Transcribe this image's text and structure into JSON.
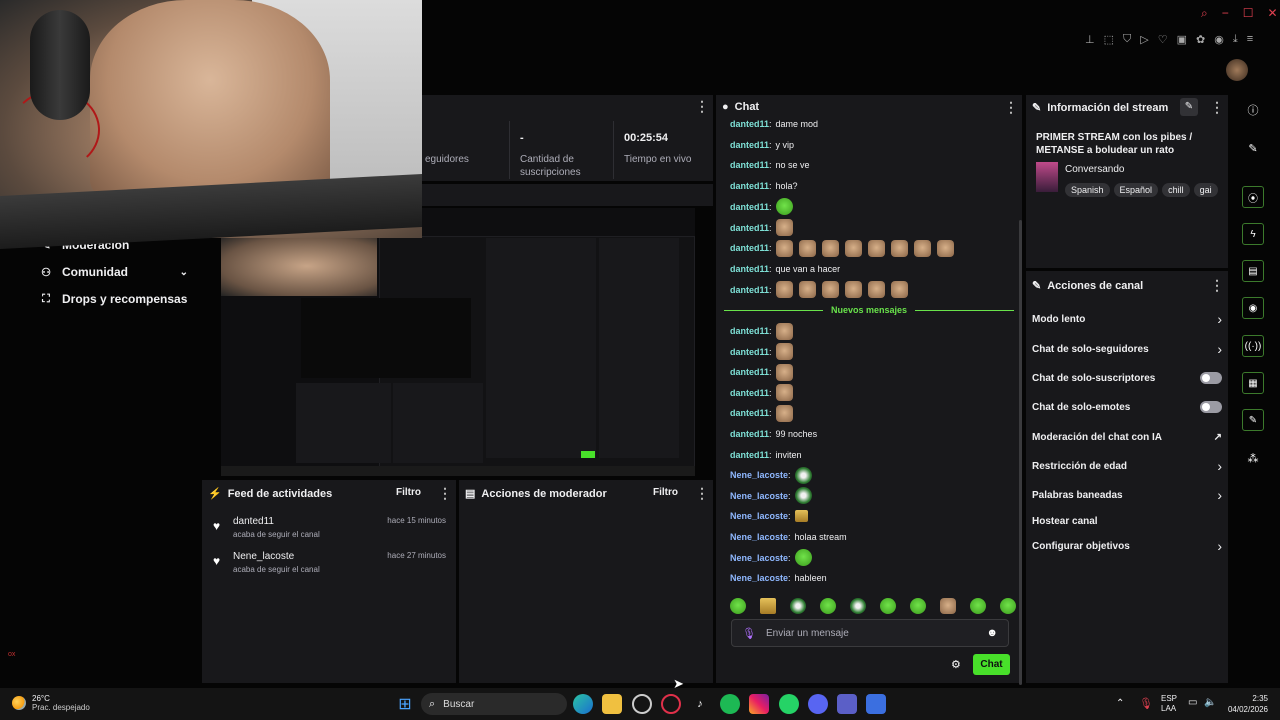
{
  "browser": {
    "window_controls": [
      "−",
      "☐",
      "✕"
    ]
  },
  "nav": {
    "moderacion": "Moderación",
    "comunidad": "Comunidad",
    "drops": "Drops y recompensas"
  },
  "stats": {
    "seguidores_label": "eguidores",
    "subs_value": "-",
    "subs_label_1": "Cantidad de",
    "subs_label_2": "suscripciones",
    "time_value": "00:25:54",
    "time_label": "Tiempo en vivo"
  },
  "feed": {
    "title": "Feed de actividades",
    "filter": "Filtro",
    "items": [
      {
        "name": "danted11",
        "sub": "acaba de seguir el canal",
        "time": "hace 15 minutos"
      },
      {
        "name": "Nene_lacoste",
        "sub": "acaba de seguir el canal",
        "time": "hace 27 minutos"
      }
    ]
  },
  "modactions": {
    "title": "Acciones de moderador",
    "filter": "Filtro"
  },
  "chat": {
    "title": "Chat",
    "messages": [
      {
        "user": "danted11",
        "text": "dame mod",
        "emotes": 0,
        "kind": ""
      },
      {
        "user": "danted11",
        "text": "y vip",
        "emotes": 0,
        "kind": ""
      },
      {
        "user": "danted11",
        "text": "no se ve",
        "emotes": 0,
        "kind": ""
      },
      {
        "user": "danted11",
        "text": "hola?",
        "emotes": 0,
        "kind": ""
      },
      {
        "user": "danted11",
        "text": "",
        "emotes": 1,
        "kind": "g"
      },
      {
        "user": "danted11",
        "text": "",
        "emotes": 1,
        "kind": ""
      },
      {
        "user": "danted11",
        "text": "",
        "emotes": 8,
        "kind": ""
      },
      {
        "user": "danted11",
        "text": "que van a hacer",
        "emotes": 0,
        "kind": ""
      },
      {
        "user": "danted11",
        "text": "",
        "emotes": 6,
        "kind": ""
      }
    ],
    "new_label": "Nuevos mensajes",
    "messages2": [
      {
        "user": "danted11",
        "text": "",
        "emotes": 1,
        "kind": ""
      },
      {
        "user": "danted11",
        "text": "",
        "emotes": 1,
        "kind": ""
      },
      {
        "user": "danted11",
        "text": "",
        "emotes": 1,
        "kind": ""
      },
      {
        "user": "danted11",
        "text": "",
        "emotes": 1,
        "kind": ""
      },
      {
        "user": "danted11",
        "text": "",
        "emotes": 1,
        "kind": ""
      },
      {
        "user": "danted11",
        "text": "99 noches",
        "emotes": 0,
        "kind": ""
      },
      {
        "user": "danted11",
        "text": "inviten",
        "emotes": 0,
        "kind": ""
      },
      {
        "user": "Nene_lacoste",
        "text": "",
        "emotes": 1,
        "kind": "b"
      },
      {
        "user": "Nene_lacoste",
        "text": "",
        "emotes": 1,
        "kind": "b"
      },
      {
        "user": "Nene_lacoste",
        "text": "",
        "emotes": 1,
        "kind": "y"
      },
      {
        "user": "Nene_lacoste",
        "text": "holaa stream",
        "emotes": 0,
        "kind": ""
      },
      {
        "user": "Nene_lacoste",
        "text": "",
        "emotes": 1,
        "kind": "g"
      },
      {
        "user": "Nene_lacoste",
        "text": "hableen",
        "emotes": 0,
        "kind": ""
      }
    ],
    "emote_bar": [
      "g",
      "y",
      "b",
      "g",
      "b",
      "g",
      "g",
      "",
      "g",
      "g"
    ],
    "placeholder": "Enviar un mensaje",
    "send": "Chat"
  },
  "stream_info": {
    "title": "Información del stream",
    "stream_title": "PRIMER STREAM con los pibes / METANSE a boludear un rato",
    "category": "Conversando",
    "tags": [
      "Spanish",
      "Español",
      "chill",
      "gai"
    ]
  },
  "channel_actions": {
    "title": "Acciones de canal",
    "items": [
      {
        "label": "Modo lento",
        "control": "chevron"
      },
      {
        "label": "Chat de solo-seguidores",
        "control": "chevron"
      },
      {
        "label": "Chat de solo-suscriptores",
        "control": "toggle"
      },
      {
        "label": "Chat de solo-emotes",
        "control": "toggle"
      },
      {
        "label": "Moderación del chat con IA",
        "control": "external"
      },
      {
        "label": "Restricción de edad",
        "control": "chevron"
      },
      {
        "label": "Palabras baneadas",
        "control": "chevron"
      },
      {
        "label": "Hostear canal",
        "control": "none"
      },
      {
        "label": "Configurar objetivos",
        "control": "chevron"
      }
    ]
  },
  "taskbar": {
    "weather_temp": "26°C",
    "weather_desc": "Prac. despejado",
    "search": "Buscar",
    "lang_1": "ESP",
    "lang_2": "LAA",
    "time": "2:35",
    "date": "04/02/2026"
  },
  "colors": {
    "accent": "#48e02a",
    "panel": "#18181b",
    "bg": "#050505"
  }
}
